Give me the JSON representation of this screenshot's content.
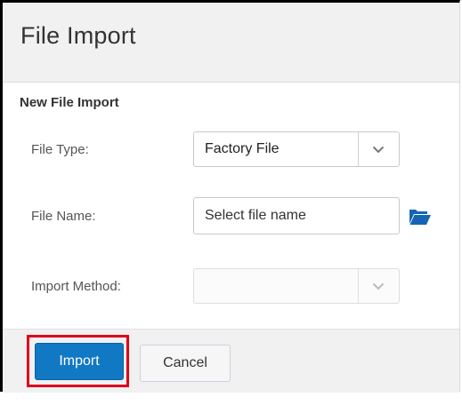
{
  "dialog": {
    "title": "File Import",
    "section_title": "New File Import"
  },
  "form": {
    "file_type": {
      "label": "File Type:",
      "value": "Factory File"
    },
    "file_name": {
      "label": "File Name:",
      "placeholder": "Select file name",
      "value": ""
    },
    "import_method": {
      "label": "Import Method:",
      "value": ""
    }
  },
  "buttons": {
    "import": "Import",
    "cancel": "Cancel"
  },
  "icons": {
    "dropdown": "chevron-down-icon",
    "browse": "folder-open-icon"
  },
  "colors": {
    "primary": "#1178c3",
    "highlight": "#e0001b",
    "browse_icon": "#1565b3"
  }
}
